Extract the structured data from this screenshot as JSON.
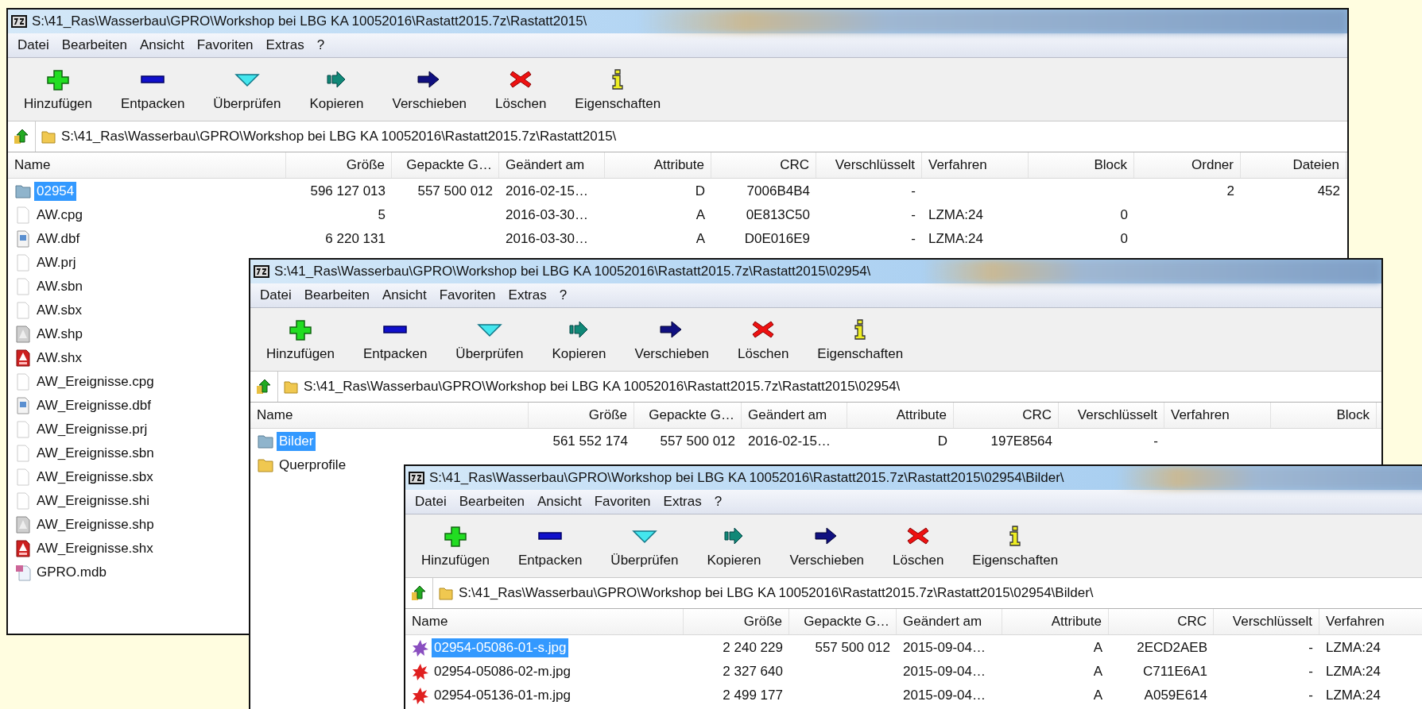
{
  "windows": [
    {
      "title": "S:\\41_Ras\\Wasserbau\\GPRO\\Workshop bei LBG KA 10052016\\Rastatt2015.7z\\Rastatt2015\\",
      "menu": [
        "Datei",
        "Bearbeiten",
        "Ansicht",
        "Favoriten",
        "Extras",
        "?"
      ],
      "toolbar": [
        {
          "label": "Hinzufügen",
          "kind": "add"
        },
        {
          "label": "Entpacken",
          "kind": "extract"
        },
        {
          "label": "Überprüfen",
          "kind": "test"
        },
        {
          "label": "Kopieren",
          "kind": "copy"
        },
        {
          "label": "Verschieben",
          "kind": "move"
        },
        {
          "label": "Löschen",
          "kind": "delete"
        },
        {
          "label": "Eigenschaften",
          "kind": "info"
        }
      ],
      "address": "S:\\41_Ras\\Wasserbau\\GPRO\\Workshop bei LBG KA 10052016\\Rastatt2015.7z\\Rastatt2015\\",
      "name_column": "Name",
      "columns": [
        "Größe",
        "Gepackte G…",
        "Geändert am",
        "Attribute",
        "CRC",
        "Verschlüsselt",
        "Verfahren",
        "Block",
        "Ordner",
        "Dateien"
      ],
      "rows": [
        {
          "kind": "folder-blue",
          "name": "02954",
          "selected": true,
          "cells": [
            "596 127 013",
            "557 500 012",
            "2016-02-15…",
            "D",
            "7006B4B4",
            "-",
            null,
            null,
            "2",
            "452"
          ]
        },
        {
          "kind": "file",
          "name": "AW.cpg",
          "selected": false,
          "cells": [
            "5",
            null,
            "2016-03-30…",
            "A",
            "0E813C50",
            "-",
            "LZMA:24",
            "0",
            null,
            null
          ]
        },
        {
          "kind": "dbf",
          "name": "AW.dbf",
          "selected": false,
          "cells": [
            "6 220 131",
            null,
            "2016-03-30…",
            "A",
            "D0E016E9",
            "-",
            "LZMA:24",
            "0",
            null,
            null
          ]
        },
        {
          "kind": "file",
          "name": "AW.prj",
          "selected": false
        },
        {
          "kind": "file",
          "name": "AW.sbn",
          "selected": false
        },
        {
          "kind": "file",
          "name": "AW.sbx",
          "selected": false
        },
        {
          "kind": "shp",
          "name": "AW.shp",
          "selected": false
        },
        {
          "kind": "shx",
          "name": "AW.shx",
          "selected": false
        },
        {
          "kind": "file",
          "name": "AW_Ereignisse.cpg",
          "selected": false
        },
        {
          "kind": "dbf",
          "name": "AW_Ereignisse.dbf",
          "selected": false
        },
        {
          "kind": "file",
          "name": "AW_Ereignisse.prj",
          "selected": false
        },
        {
          "kind": "file",
          "name": "AW_Ereignisse.sbn",
          "selected": false
        },
        {
          "kind": "file",
          "name": "AW_Ereignisse.sbx",
          "selected": false
        },
        {
          "kind": "file",
          "name": "AW_Ereignisse.shi",
          "selected": false
        },
        {
          "kind": "shp",
          "name": "AW_Ereignisse.shp",
          "selected": false
        },
        {
          "kind": "shx",
          "name": "AW_Ereignisse.shx",
          "selected": false
        },
        {
          "kind": "mdb",
          "name": "GPRO.mdb",
          "selected": false
        }
      ]
    },
    {
      "title": "S:\\41_Ras\\Wasserbau\\GPRO\\Workshop bei LBG KA 10052016\\Rastatt2015.7z\\Rastatt2015\\02954\\",
      "menu": [
        "Datei",
        "Bearbeiten",
        "Ansicht",
        "Favoriten",
        "Extras",
        "?"
      ],
      "toolbar": [
        {
          "label": "Hinzufügen",
          "kind": "add"
        },
        {
          "label": "Entpacken",
          "kind": "extract"
        },
        {
          "label": "Überprüfen",
          "kind": "test"
        },
        {
          "label": "Kopieren",
          "kind": "copy"
        },
        {
          "label": "Verschieben",
          "kind": "move"
        },
        {
          "label": "Löschen",
          "kind": "delete"
        },
        {
          "label": "Eigenschaften",
          "kind": "info"
        }
      ],
      "address": "S:\\41_Ras\\Wasserbau\\GPRO\\Workshop bei LBG KA 10052016\\Rastatt2015.7z\\Rastatt2015\\02954\\",
      "name_column": "Name",
      "columns": [
        "Größe",
        "Gepackte G…",
        "Geändert am",
        "Attribute",
        "CRC",
        "Verschlüsselt",
        "Verfahren",
        "Block"
      ],
      "rows": [
        {
          "kind": "folder-blue",
          "name": "Bilder",
          "selected": true,
          "cells": [
            "561 552 174",
            "557 500 012",
            "2016-02-15…",
            "D",
            "197E8564",
            "-",
            null,
            null
          ]
        },
        {
          "kind": "folder",
          "name": "Querprofile",
          "selected": false
        }
      ]
    },
    {
      "title": "S:\\41_Ras\\Wasserbau\\GPRO\\Workshop bei LBG KA 10052016\\Rastatt2015.7z\\Rastatt2015\\02954\\Bilder\\",
      "menu": [
        "Datei",
        "Bearbeiten",
        "Ansicht",
        "Favoriten",
        "Extras",
        "?"
      ],
      "toolbar": [
        {
          "label": "Hinzufügen",
          "kind": "add"
        },
        {
          "label": "Entpacken",
          "kind": "extract"
        },
        {
          "label": "Überprüfen",
          "kind": "test"
        },
        {
          "label": "Kopieren",
          "kind": "copy"
        },
        {
          "label": "Verschieben",
          "kind": "move"
        },
        {
          "label": "Löschen",
          "kind": "delete"
        },
        {
          "label": "Eigenschaften",
          "kind": "info"
        }
      ],
      "address": "S:\\41_Ras\\Wasserbau\\GPRO\\Workshop bei LBG KA 10052016\\Rastatt2015.7z\\Rastatt2015\\02954\\Bilder\\",
      "name_column": "Name",
      "columns": [
        "Größe",
        "Gepackte G…",
        "Geändert am",
        "Attribute",
        "CRC",
        "Verschlüsselt",
        "Verfahren"
      ],
      "rows": [
        {
          "kind": "jpg-purple",
          "name": "02954-05086-01-s.jpg",
          "selected": true,
          "cells": [
            "2 240 229",
            "557 500 012",
            "2015-09-04…",
            "A",
            "2ECD2AEB",
            "-",
            "LZMA:24"
          ]
        },
        {
          "kind": "jpg-red",
          "name": "02954-05086-02-m.jpg",
          "selected": false,
          "cells": [
            "2 327 640",
            null,
            "2015-09-04…",
            "A",
            "C711E6A1",
            "-",
            "LZMA:24"
          ]
        },
        {
          "kind": "jpg-red",
          "name": "02954-05136-01-m.jpg",
          "selected": false,
          "cells": [
            "2 499 177",
            null,
            "2015-09-04…",
            "A",
            "A059E614",
            "-",
            "LZMA:24"
          ]
        }
      ]
    }
  ]
}
